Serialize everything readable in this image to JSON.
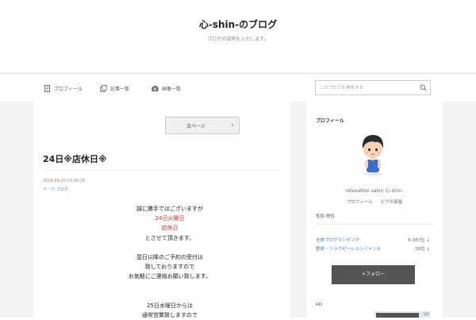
{
  "header": {
    "title": "心-shin-のブログ",
    "description": "ブログの説明を入力します。"
  },
  "nav": {
    "items": [
      {
        "label": "プロフィール",
        "icon": "profile-icon"
      },
      {
        "label": "記事一覧",
        "icon": "articles-icon"
      },
      {
        "label": "画像一覧",
        "icon": "camera-icon"
      }
    ],
    "search_placeholder": "このブログを検索する"
  },
  "article": {
    "next_page_label": "次ページ",
    "title": "24日※店休日※",
    "date": "2019-09-23 10:00:28",
    "theme_label": "テーマ:",
    "theme_value": "ブログ",
    "lines": [
      {
        "text": "誠に勝手ではございますが",
        "color": "#222222"
      },
      {
        "text": "24日火曜日",
        "color": "#e02020"
      },
      {
        "text": "店休日",
        "color": "#e02020"
      },
      {
        "text": "とさせて頂きます。",
        "color": "#222222"
      },
      {
        "text": "",
        "color": "#222222"
      },
      {
        "text": "翌日以降のご予約の受付は",
        "color": "#222222"
      },
      {
        "text": "致しておりますので",
        "color": "#222222"
      },
      {
        "text": "お気軽にご連絡お願い致します。",
        "color": "#222222"
      },
      {
        "text": "",
        "color": "#222222"
      },
      {
        "text": "",
        "color": "#222222"
      },
      {
        "text": "25日水曜日からは",
        "color": "#222222"
      },
      {
        "text": "通常営業致しますので",
        "color": "#222222"
      }
    ]
  },
  "sidebar": {
    "profile_heading": "プロフィール",
    "name": "relaxation salon 心-shin-",
    "links": [
      "プロフィール",
      "ピグの部屋"
    ],
    "gender": "性別:男性",
    "rankings": [
      {
        "label": "全体ブログランキング",
        "value": "6,087位 ↓"
      },
      {
        "label": "整体・リラクゼーションジャンル",
        "value": "28位 ↓"
      }
    ],
    "follow_label": "+フォロー",
    "ad_label": "AD",
    "ad_tag": "iDX"
  },
  "colors": {
    "accent_link": "#3b7bbf",
    "highlight_red": "#e02020",
    "follow_button": "#555555"
  }
}
